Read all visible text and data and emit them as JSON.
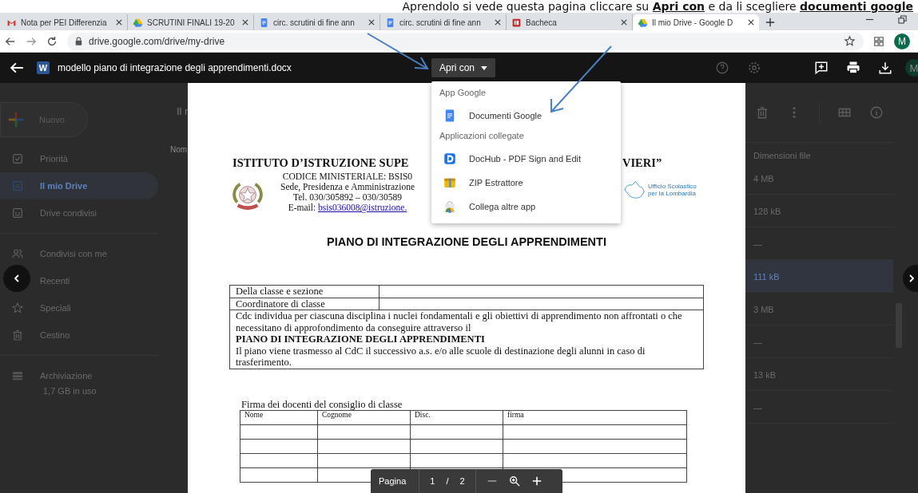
{
  "caption": "Aprendolo si vede questa pagina cliccare su **Apri con** e da li scegliere **documenti google**",
  "browser": {
    "tabs": [
      {
        "title": "Nota per PEI Differenzia",
        "kind": "gmail",
        "selected": false
      },
      {
        "title": "SCRUTINI FINALI 19-20",
        "kind": "drive",
        "selected": false
      },
      {
        "title": "circ. scrutini di fine ann",
        "kind": "docs",
        "selected": false
      },
      {
        "title": "circ. scrutini di fine ann",
        "kind": "docs",
        "selected": false
      },
      {
        "title": "Bacheca",
        "kind": "site",
        "selected": false
      },
      {
        "title": "Il mio Drive - Google D",
        "kind": "drive",
        "selected": true
      }
    ],
    "url": "drive.google.com/drive/my-drive",
    "avatar": "M"
  },
  "viewer": {
    "badge": "W",
    "file_name": "modello piano di integrazione degli apprendimenti.docx",
    "open_with": {
      "label": "Apri con",
      "expanded": true
    },
    "avatar": "M"
  },
  "menu": {
    "sections": [
      {
        "heading": "App Google",
        "items": [
          {
            "label": "Documenti Google",
            "kind": "docs"
          }
        ]
      },
      {
        "heading": "Applicazioni collegate",
        "items": [
          {
            "label": "DocHub - PDF Sign and Edit",
            "kind": "dochub"
          },
          {
            "label": "ZIP Estrattore",
            "kind": "zip"
          },
          {
            "label": "Collega altre app",
            "kind": "store"
          }
        ]
      }
    ]
  },
  "drive": {
    "new_button": "Nuovo",
    "nav_groups": [
      [
        {
          "label": "Priorità",
          "kind": "priority",
          "selected": false
        },
        {
          "label": "Il mio Drive",
          "kind": "mydrive",
          "selected": true
        },
        {
          "label": "Drive condivisi",
          "kind": "shared",
          "selected": false
        }
      ],
      [
        {
          "label": "Condivisi con me",
          "kind": "people",
          "selected": false
        },
        {
          "label": "Recenti",
          "kind": "clock",
          "selected": false
        },
        {
          "label": "Speciali",
          "kind": "star",
          "selected": false
        },
        {
          "label": "Cestino",
          "kind": "trash",
          "selected": false
        }
      ]
    ],
    "storage": {
      "label": "Archiviazione",
      "usage": "1,7 GB in uso"
    },
    "breadcrumb": "Il r",
    "name_column": "Nom",
    "size_column": "Dimensioni file",
    "sizes": [
      {
        "text": "4 MB",
        "selected": false
      },
      {
        "text": "128 kB",
        "selected": false
      },
      {
        "text": "—",
        "selected": false
      },
      {
        "text": "111 kB",
        "selected": true
      },
      {
        "text": "3 MB",
        "selected": false
      },
      {
        "text": "—",
        "selected": false
      },
      {
        "text": "13 kB",
        "selected": false
      },
      {
        "text": "—",
        "selected": false
      }
    ]
  },
  "document": {
    "institute_left": "ISTITUTO D’ISTRUZIONE SUPE",
    "institute_right": "VIERI”",
    "header_lines": [
      "CODICE MINISTERIALE: BSIS0",
      "Sede, Presidenza e Amministrazione",
      "Tel. 030/305892 – 030/30589"
    ],
    "email_label": "E-mail:",
    "email_link": "bsis036008@istruzione.",
    "region_logo": "Ufficio Scolastico per la Lombardia",
    "title": "PIANO DI INTEGRAZIONE DEGLI APPRENDIMENTI",
    "info_rows": [
      "Della classe e sezione",
      "Coordinatore di classe"
    ],
    "info_text": "Cdc individua per ciascuna disciplina i nuclei fondamentali e gli obiettivi di apprendimento non affrontati o che necessitano di approfondimento da conseguire attraverso il",
    "info_bold": "PIANO DI INTEGRAZIONE DEGLI APPRENDIMENTI",
    "info_note": "Il piano viene trasmesso al CdC  il successivo a.s. e/o  alle scuole di destinazione degli alunni in caso di trasferimento.",
    "signature_caption": "Firma dei docenti del consiglio di classe",
    "signature_columns": [
      "Nome",
      "Cognome",
      "Disc.",
      "firma"
    ]
  },
  "page_nav": {
    "label": "Pagina",
    "current": "1",
    "separator": "/",
    "total": "2"
  }
}
